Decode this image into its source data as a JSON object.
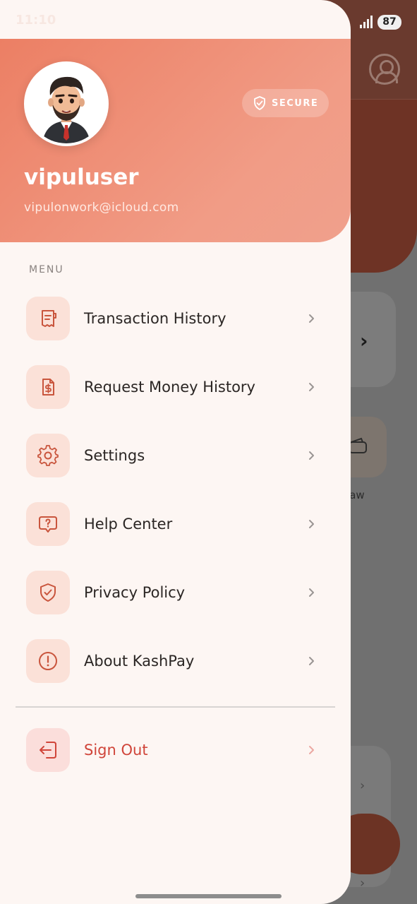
{
  "status_bar": {
    "time": "11:10",
    "battery": "87"
  },
  "profile": {
    "name": "vipuluser",
    "email": "vipulonwork@icloud.com",
    "secure_label": "SECURE"
  },
  "menu": {
    "heading": "MENU",
    "items": [
      {
        "label": "Transaction History",
        "icon": "receipt-icon"
      },
      {
        "label": "Request Money History",
        "icon": "dollar-document-icon"
      },
      {
        "label": "Settings",
        "icon": "gear-icon"
      },
      {
        "label": "Help Center",
        "icon": "question-bubble-icon"
      },
      {
        "label": "Privacy Policy",
        "icon": "shield-check-icon"
      },
      {
        "label": "About KashPay",
        "icon": "info-circle-icon"
      }
    ],
    "sign_out": {
      "label": "Sign Out",
      "icon": "logout-icon"
    }
  },
  "background": {
    "withdraw_label": "ndraw"
  },
  "colors": {
    "accent": "#ec7f64",
    "icon_tile": "#fbe1d8",
    "icon_stroke": "#c9553d",
    "sign_out": "#d0453a"
  }
}
